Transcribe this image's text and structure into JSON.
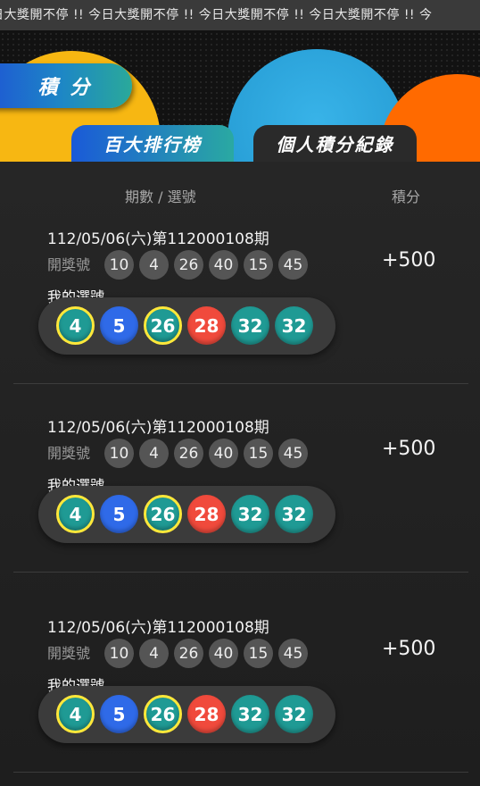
{
  "marquee": {
    "text": "日大獎開不停 !! 今日大獎開不停 !! 今日大獎開不停 !! 今日大獎開不停 !! 今"
  },
  "header": {
    "score_pill": "積 分",
    "tabs": [
      {
        "label": "百大排行榜",
        "active": false
      },
      {
        "label": "個人積分紀錄",
        "active": true
      }
    ]
  },
  "table": {
    "col_draw": "期數 / 選號",
    "col_score": "積分"
  },
  "records": [
    {
      "date": "112/05/06(六)第112000108期",
      "draw_label": "開獎號",
      "draw_numbers": [
        "10",
        "4",
        "26",
        "40",
        "15",
        "45"
      ],
      "score": "+500",
      "my_label": "我的選號",
      "my_numbers": [
        {
          "n": "4",
          "color": "#1f9a94",
          "hit": true
        },
        {
          "n": "5",
          "color": "#2f6ae8",
          "hit": false
        },
        {
          "n": "26",
          "color": "#1f9a94",
          "hit": true
        },
        {
          "n": "28",
          "color": "#f04a3c",
          "hit": false
        },
        {
          "n": "32",
          "color": "#1f9a94",
          "hit": false
        },
        {
          "n": "32",
          "color": "#1f9a94",
          "hit": false
        }
      ]
    },
    {
      "date": "112/05/06(六)第112000108期",
      "draw_label": "開獎號",
      "draw_numbers": [
        "10",
        "4",
        "26",
        "40",
        "15",
        "45"
      ],
      "score": "+500",
      "my_label": "我的選號",
      "my_numbers": [
        {
          "n": "4",
          "color": "#1f9a94",
          "hit": true
        },
        {
          "n": "5",
          "color": "#2f6ae8",
          "hit": false
        },
        {
          "n": "26",
          "color": "#1f9a94",
          "hit": true
        },
        {
          "n": "28",
          "color": "#f04a3c",
          "hit": false
        },
        {
          "n": "32",
          "color": "#1f9a94",
          "hit": false
        },
        {
          "n": "32",
          "color": "#1f9a94",
          "hit": false
        }
      ]
    },
    {
      "date": "112/05/06(六)第112000108期",
      "draw_label": "開獎號",
      "draw_numbers": [
        "10",
        "4",
        "26",
        "40",
        "15",
        "45"
      ],
      "score": "+500",
      "my_label": "我的選號",
      "my_numbers": [
        {
          "n": "4",
          "color": "#1f9a94",
          "hit": true
        },
        {
          "n": "5",
          "color": "#2f6ae8",
          "hit": false
        },
        {
          "n": "26",
          "color": "#1f9a94",
          "hit": true
        },
        {
          "n": "28",
          "color": "#f04a3c",
          "hit": false
        },
        {
          "n": "32",
          "color": "#1f9a94",
          "hit": false
        },
        {
          "n": "32",
          "color": "#1f9a94",
          "hit": false
        }
      ]
    }
  ]
}
